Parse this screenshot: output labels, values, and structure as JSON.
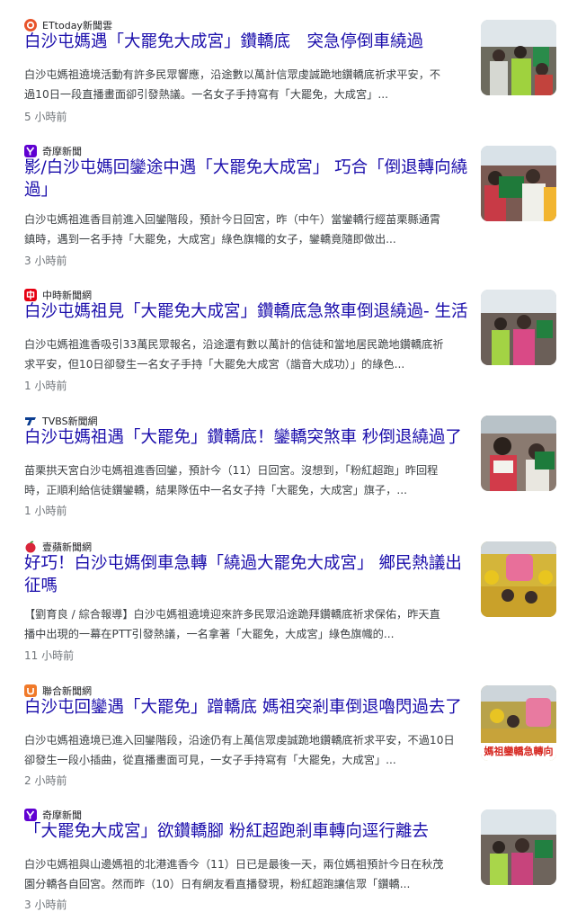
{
  "articles": [
    {
      "source": "ETtoday新聞雲",
      "logo_icon": "ettoday-logo-icon",
      "logo_color": "#e8542b",
      "title_lines": [
        "白沙屯媽遇「大罷免大成宮」鑽轎底　突急停倒車繞過"
      ],
      "snippet_lines": [
        "白沙屯媽祖遶境活動有許多民眾響應，沿途數以萬計信眾虔誠跪地鑽轎底祈求平安，不",
        "過10日一段直播畫面卻引發熱議。一名女子手持寫有「大罷免，大成宮」..."
      ],
      "time": "5 小時前"
    },
    {
      "source": "奇摩新聞",
      "logo_icon": "yahoo-logo-icon",
      "logo_color": "#6001d2",
      "title_lines": [
        "影/白沙屯媽回鑾途中遇「大罷免大成宮」 巧合「倒退轉向繞",
        "過」"
      ],
      "snippet_lines": [
        "白沙屯媽祖進香目前進入回鑾階段，預計今日回宮，昨（中午）當鑾轎行經苗栗縣通霄",
        "鎮時，遇到一名手持「大罷免，大成宮」綠色旗幟的女子，鑾轎竟隨即做出..."
      ],
      "time": "3 小時前"
    },
    {
      "source": "中時新聞網",
      "logo_icon": "chinatimes-logo-icon",
      "logo_color": "#e60012",
      "title_lines": [
        "白沙屯媽祖見「大罷免大成宮」鑽轎底急煞車倒退繞過- 生活"
      ],
      "snippet_lines": [
        "白沙屯媽祖進香吸引33萬民眾報名，沿途還有數以萬計的信徒和當地居民跪地鑽轎底祈",
        "求平安，但10日卻發生一名女子手持「大罷免大成宮（諧音大成功）」的綠色..."
      ],
      "time": "1 小時前"
    },
    {
      "source": "TVBS新聞網",
      "logo_icon": "tvbs-logo-icon",
      "logo_color": "#0a3d91",
      "title_lines": [
        "白沙屯媽祖遇「大罷免」鑽轎底！鑾轎突煞車 秒倒退繞過了"
      ],
      "snippet_lines": [
        "苗栗拱天宮白沙屯媽祖進香回鑾，預計今（11）日回宮。沒想到，「粉紅超跑」昨回程",
        "時，正順利給信徒鑽鑾轎，結果隊伍中一名女子持「大罷免，大成宮」旗子，..."
      ],
      "time": "1 小時前"
    },
    {
      "source": "壹蘋新聞網",
      "logo_icon": "nextapple-logo-icon",
      "logo_color": "#d9263a",
      "title_lines": [
        "好巧！白沙屯媽倒車急轉「繞過大罷免大成宮」 鄉民熱議出",
        "征嗎"
      ],
      "snippet_lines": [
        "【劉育良 / 綜合報導】白沙屯媽祖遶境迎來許多民眾沿途跪拜鑽轎底祈求保佑，昨天直",
        "播中出現的一幕在PTT引發熱議，一名拿著「大罷免，大成宮」綠色旗幟的..."
      ],
      "time": "11 小時前"
    },
    {
      "source": "聯合新聞網",
      "logo_icon": "udn-logo-icon",
      "logo_color": "#f07a2a",
      "title_lines": [
        "白沙屯回鑾遇「大罷免」蹭轎底 媽祖突剎車倒退嚕閃過去了"
      ],
      "snippet_lines": [
        "白沙屯媽祖遶境已進入回鑾階段，沿途仍有上萬信眾虔誠跪地鑽轎底祈求平安，不過10日",
        "卻發生一段小插曲，從直播畫面可見，一女子手持寫有「大罷免，大成宮」..."
      ],
      "time": "2 小時前",
      "thumb_caption": "媽祖鑾轎急轉向"
    },
    {
      "source": "奇摩新聞",
      "logo_icon": "yahoo-logo-icon",
      "logo_color": "#6001d2",
      "title_lines": [
        "「大罷免大成宮」欲鑽轎腳 粉紅超跑剎車轉向逕行離去"
      ],
      "snippet_lines": [
        "白沙屯媽祖與山邊媽祖的北港進香今（11）日已是最後一天，兩位媽祖預計今日在秋茂",
        "園分轎各自回宮。然而昨（10）日有網友看直播發現，粉紅超跑讓信眾「鑽轎..."
      ],
      "time": "3 小時前"
    }
  ]
}
